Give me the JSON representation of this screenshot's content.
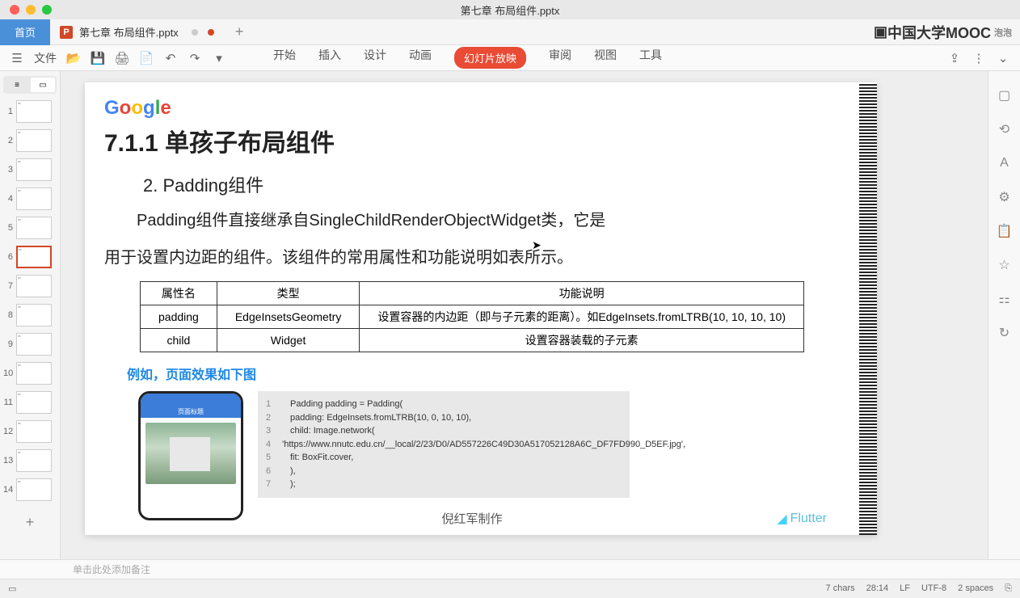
{
  "window": {
    "title": "第七章 布局组件.pptx"
  },
  "tabs": {
    "home": "首页",
    "file": "第七章 布局组件.pptx",
    "add": "+"
  },
  "mooc": {
    "text": "中国大学MOOC",
    "badge": "泡泡"
  },
  "toolbar": {
    "file_menu": "文件",
    "menus": [
      "开始",
      "插入",
      "设计",
      "动画",
      "幻灯片放映",
      "审阅",
      "视图",
      "工具"
    ],
    "active_index": 4
  },
  "thumbnails": [
    {
      "n": 1
    },
    {
      "n": 2
    },
    {
      "n": 3
    },
    {
      "n": 4
    },
    {
      "n": 5
    },
    {
      "n": 6,
      "selected": true
    },
    {
      "n": 7
    },
    {
      "n": 8
    },
    {
      "n": 9
    },
    {
      "n": 10
    },
    {
      "n": 11
    },
    {
      "n": 12
    },
    {
      "n": 13
    },
    {
      "n": 14
    }
  ],
  "slide": {
    "google": [
      "G",
      "o",
      "o",
      "g",
      "l",
      "e"
    ],
    "title": "7.1.1 单孩子布局组件",
    "subtitle": "2.  Padding组件",
    "body1": "Padding组件直接继承自SingleChildRenderObjectWidget类，它是",
    "body2": "用于设置内边距的组件。该组件的常用属性和功能说明如表所示。",
    "table": {
      "headers": [
        "属性名",
        "类型",
        "功能说明"
      ],
      "rows": [
        [
          "padding",
          "EdgeInsetsGeometry",
          "设置容器的内边距（即与子元素的距离）。如EdgeInsets.fromLTRB(10, 10, 10, 10)"
        ],
        [
          "child",
          "Widget",
          "设置容器装载的子元素"
        ]
      ]
    },
    "example_label": "例如，页面效果如下图",
    "phone_appbar": "页面标题",
    "code": [
      "Padding padding = Padding(",
      "    padding: EdgeInsets.fromLTRB(10, 0, 10, 10),",
      "    child: Image.network(",
      "'https://www.nnutc.edu.cn/__local/2/23/D0/AD557226C49D30A517052128A6C_DF7FD990_D5EF.jpg',",
      "        fit: BoxFit.cover,",
      "    ),",
      ");"
    ],
    "footer": "倪红军制作",
    "flutter": "Flutter"
  },
  "notes": {
    "placeholder": "单击此处添加备注"
  },
  "status": {
    "chars": "7 chars",
    "pos": "28:14",
    "lf": "LF",
    "encoding": "UTF-8",
    "spaces": "2 spaces"
  }
}
